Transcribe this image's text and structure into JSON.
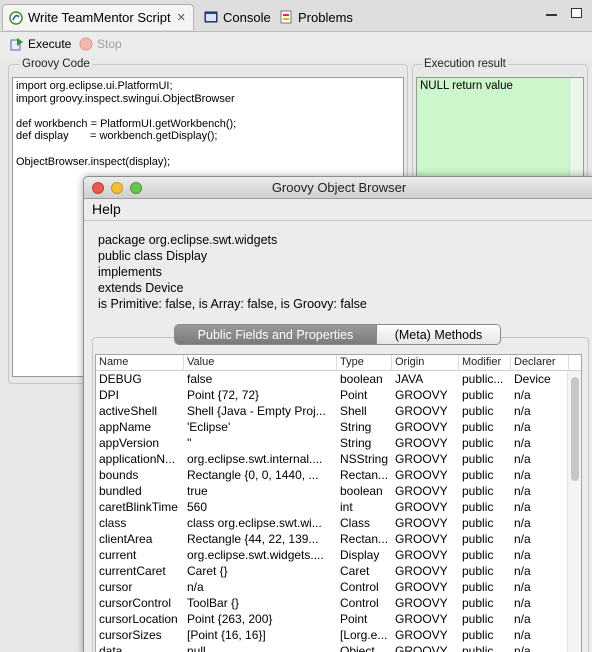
{
  "tabs": [
    {
      "label": "Write TeamMentor Script",
      "icon": "groovy-icon",
      "active": true
    },
    {
      "label": "Console",
      "icon": "console-icon"
    },
    {
      "label": "Problems",
      "icon": "problems-icon"
    }
  ],
  "toolbar": {
    "execute_label": "Execute",
    "stop_label": "Stop"
  },
  "groovy_code": {
    "label": "Groovy Code",
    "lines": [
      "import org.eclipse.ui.PlatformUI;",
      "import groovy.inspect.swingui.ObjectBrowser",
      "",
      "def workbench = PlatformUI.getWorkbench();",
      "def display       = workbench.getDisplay();",
      "",
      "ObjectBrowser.inspect(display);"
    ]
  },
  "execution_result": {
    "label": "Execution result",
    "value": "NULL return value"
  },
  "browser": {
    "title": "Groovy Object Browser",
    "menu_help": "Help",
    "info": [
      "package org.eclipse.swt.widgets",
      "public class Display",
      "implements",
      "extends Device",
      "is Primitive: false, is Array: false, is Groovy: false"
    ],
    "tab_fields": "Public Fields and Properties",
    "tab_methods": "(Meta) Methods",
    "columns": [
      "Name",
      "Value",
      "Type",
      "Origin",
      "Modifier",
      "Declarer"
    ],
    "rows": [
      [
        "DEBUG",
        "false",
        "boolean",
        "JAVA",
        "public...",
        "Device"
      ],
      [
        "DPI",
        "Point {72, 72}",
        "Point",
        "GROOVY",
        "public",
        "n/a"
      ],
      [
        "activeShell",
        "Shell {Java - Empty Proj...",
        "Shell",
        "GROOVY",
        "public",
        "n/a"
      ],
      [
        "appName",
        "'Eclipse'",
        "String",
        "GROOVY",
        "public",
        "n/a"
      ],
      [
        "appVersion",
        "''",
        "String",
        "GROOVY",
        "public",
        "n/a"
      ],
      [
        "applicationN...",
        "org.eclipse.swt.internal....",
        "NSString",
        "GROOVY",
        "public",
        "n/a"
      ],
      [
        "bounds",
        "Rectangle {0, 0, 1440, ...",
        "Rectan...",
        "GROOVY",
        "public",
        "n/a"
      ],
      [
        "bundled",
        "true",
        "boolean",
        "GROOVY",
        "public",
        "n/a"
      ],
      [
        "caretBlinkTime",
        "560",
        "int",
        "GROOVY",
        "public",
        "n/a"
      ],
      [
        "class",
        "class org.eclipse.swt.wi...",
        "Class",
        "GROOVY",
        "public",
        "n/a"
      ],
      [
        "clientArea",
        "Rectangle {44, 22, 139...",
        "Rectan...",
        "GROOVY",
        "public",
        "n/a"
      ],
      [
        "current",
        "org.eclipse.swt.widgets....",
        "Display",
        "GROOVY",
        "public",
        "n/a"
      ],
      [
        "currentCaret",
        "Caret {}",
        "Caret",
        "GROOVY",
        "public",
        "n/a"
      ],
      [
        "cursor",
        "n/a",
        "Control",
        "GROOVY",
        "public",
        "n/a"
      ],
      [
        "cursorControl",
        "ToolBar {}",
        "Control",
        "GROOVY",
        "public",
        "n/a"
      ],
      [
        "cursorLocation",
        "Point {263, 200}",
        "Point",
        "GROOVY",
        "public",
        "n/a"
      ],
      [
        "cursorSizes",
        "[Point {16, 16}]",
        "[Lorg.e...",
        "GROOVY",
        "public",
        "n/a"
      ],
      [
        "data",
        "null",
        "Object",
        "GROOVY",
        "public",
        "n/a"
      ]
    ]
  },
  "colors": {
    "result_bg": "#ccf7cc",
    "segment_selected": "#858585"
  }
}
